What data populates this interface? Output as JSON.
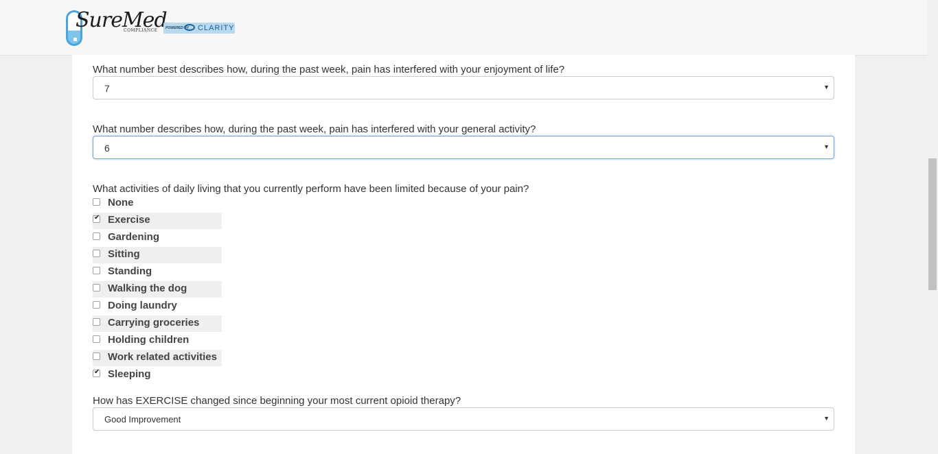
{
  "brand": {
    "logo_text": "SureMed",
    "logo_subtext": "COMPLIANCE",
    "powered_by": "POWERED BY",
    "partner": "CLARITY",
    "accent": "#4aa3d9"
  },
  "form": {
    "q_enjoyment": {
      "label": "What number best describes how, during the past week, pain has interfered with your enjoyment of life?",
      "value": "7"
    },
    "q_activity": {
      "label": "What number describes how, during the past week, pain has interfered with your general activity?",
      "value": "6"
    },
    "q_limited": {
      "label": "What activities of daily living that you currently perform have been limited because of your pain?",
      "options": [
        {
          "label": "None",
          "checked": false
        },
        {
          "label": "Exercise",
          "checked": true
        },
        {
          "label": "Gardening",
          "checked": false
        },
        {
          "label": "Sitting",
          "checked": false
        },
        {
          "label": "Standing",
          "checked": false
        },
        {
          "label": "Walking the dog",
          "checked": false
        },
        {
          "label": "Doing laundry",
          "checked": false
        },
        {
          "label": "Carrying groceries",
          "checked": false
        },
        {
          "label": "Holding children",
          "checked": false
        },
        {
          "label": "Work related activities",
          "checked": false
        },
        {
          "label": "Sleeping",
          "checked": true
        }
      ]
    },
    "q_exercise_change": {
      "label": "How has EXERCISE changed since beginning your most current opioid therapy?",
      "value": "Good Improvement"
    }
  }
}
